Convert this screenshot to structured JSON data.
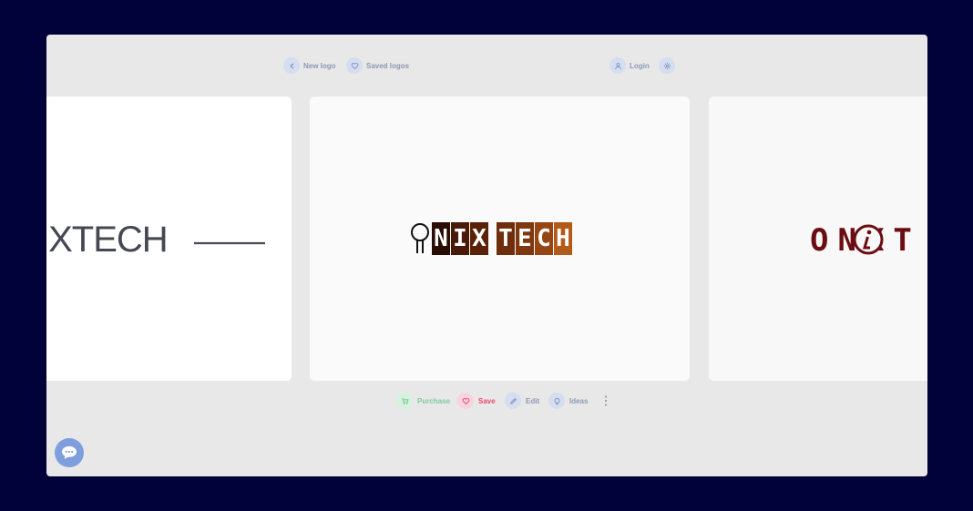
{
  "nav": {
    "new_logo_label": "New logo",
    "saved_logos_label": "Saved logos",
    "login_label": "Login"
  },
  "logos": {
    "left": "IXTECH",
    "center_word1": [
      "N",
      "I",
      "X"
    ],
    "center_word2": [
      "T",
      "E",
      "C",
      "H"
    ],
    "center_colors": [
      "#2a0d04",
      "#4a1a08",
      "#5a2108",
      "#6e2e0c",
      "#7e370e",
      "#954612",
      "#b35a1a"
    ],
    "right": "ONXT"
  },
  "toolbar": {
    "purchase_label": "Purchase",
    "save_label": "Save",
    "edit_label": "Edit",
    "ideas_label": "Ideas"
  },
  "colors": {
    "background": "#02023a",
    "panel": "#e8e8e8",
    "purchase": "#7fc99b",
    "save": "#e8466e",
    "accent": "#8c98b5",
    "chat": "#7e9ede"
  }
}
